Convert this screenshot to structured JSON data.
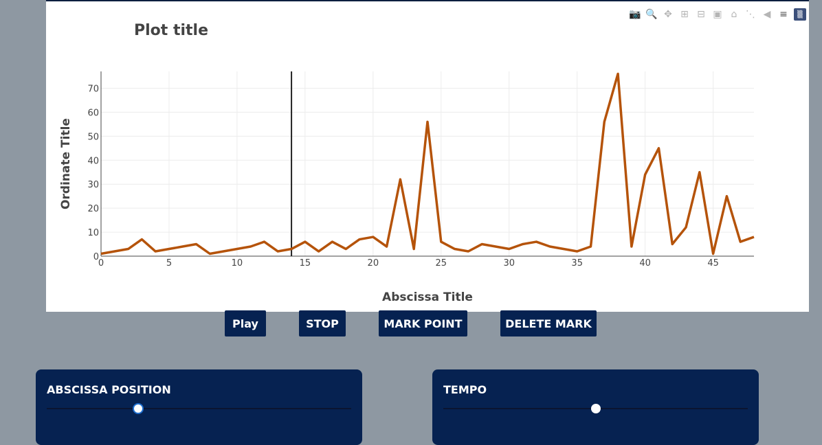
{
  "plot": {
    "title": "Plot title",
    "modebar_icons": [
      "camera-icon",
      "zoom-icon",
      "pan-icon",
      "zoom-in-icon",
      "zoom-out-icon",
      "autoscale-icon",
      "home-icon",
      "spike-icon",
      "hover-closest-icon",
      "hover-compare-icon",
      "plotly-logo-icon"
    ]
  },
  "chart_data": {
    "type": "line",
    "title": "Plot title",
    "xlabel": "Abscissa Title",
    "ylabel": "Ordinate Title",
    "xlim": [
      0,
      48
    ],
    "ylim": [
      0,
      77
    ],
    "xticks": [
      0,
      5,
      10,
      15,
      20,
      25,
      30,
      35,
      40,
      45
    ],
    "yticks": [
      0,
      10,
      20,
      30,
      40,
      50,
      60,
      70
    ],
    "line_color": "#b5530a",
    "cursor_x": 14,
    "x": [
      0,
      1,
      2,
      3,
      4,
      5,
      6,
      7,
      8,
      9,
      10,
      11,
      12,
      13,
      14,
      15,
      16,
      17,
      18,
      19,
      20,
      21,
      22,
      23,
      24,
      25,
      26,
      27,
      28,
      29,
      30,
      31,
      32,
      33,
      34,
      35,
      36,
      37,
      38,
      39,
      40,
      41,
      42,
      43,
      44,
      45,
      46,
      47,
      48
    ],
    "series": [
      {
        "values": [
          1,
          2,
          3,
          7,
          2,
          3,
          4,
          5,
          1,
          2,
          3,
          4,
          6,
          2,
          3,
          6,
          2,
          6,
          3,
          7,
          8,
          4,
          32,
          3,
          56,
          6,
          3,
          2,
          5,
          4,
          3,
          5,
          6,
          4,
          3,
          2,
          4,
          56,
          76,
          4,
          34,
          45,
          5,
          12,
          35,
          1,
          25,
          6,
          8
        ]
      }
    ]
  },
  "buttons": {
    "play": "Play",
    "stop": "STOP",
    "mark_point": "MARK POINT",
    "delete_mark": "DELETE MARK"
  },
  "sliders": {
    "abscissa_label": "ABSCISSA POSITION",
    "abscissa_value": 0.3,
    "tempo_label": "TEMPO",
    "tempo_value": 0.5
  },
  "colors": {
    "accent": "#062251",
    "line": "#b5530a",
    "background": "#8e98a2"
  }
}
